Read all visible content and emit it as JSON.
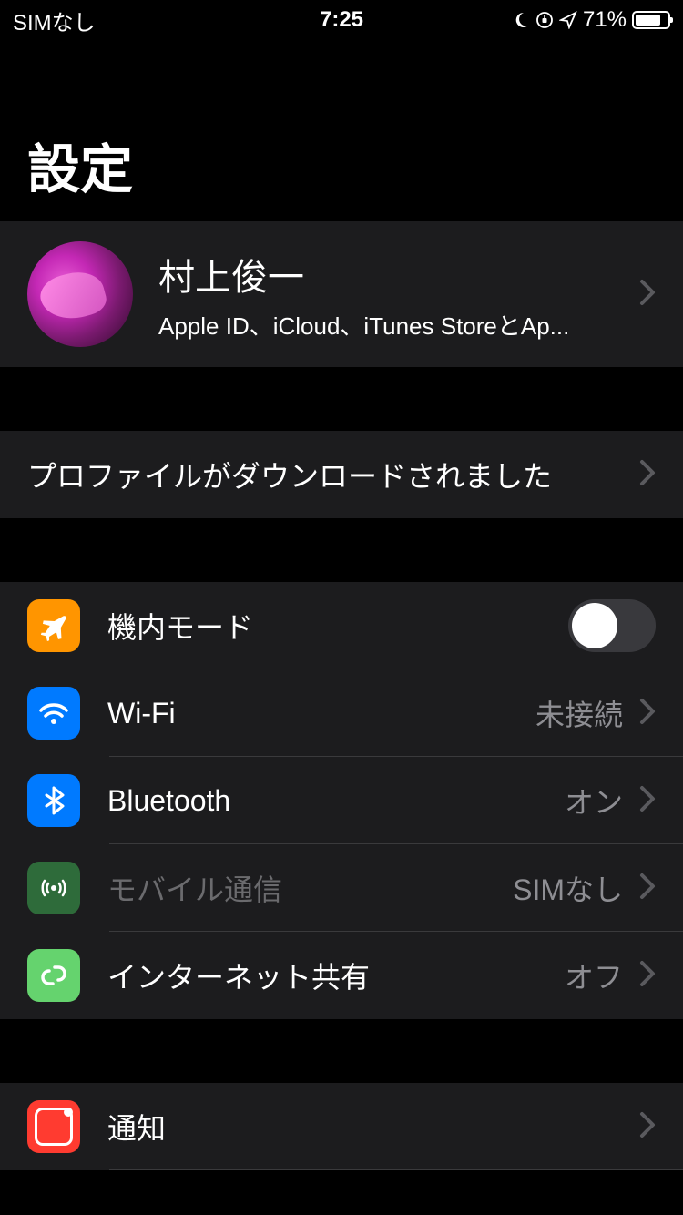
{
  "status_bar": {
    "carrier": "SIMなし",
    "time": "7:25",
    "battery_percent": "71%"
  },
  "page_title": "設定",
  "profile": {
    "name": "村上俊一",
    "subtitle": "Apple ID、iCloud、iTunes StoreとAp..."
  },
  "profile_download": {
    "label": "プロファイルがダウンロードされました"
  },
  "connectivity": {
    "airplane": {
      "label": "機内モード",
      "on": false
    },
    "wifi": {
      "label": "Wi-Fi",
      "value": "未接続"
    },
    "bluetooth": {
      "label": "Bluetooth",
      "value": "オン"
    },
    "cellular": {
      "label": "モバイル通信",
      "value": "SIMなし",
      "disabled": true
    },
    "hotspot": {
      "label": "インターネット共有",
      "value": "オフ"
    }
  },
  "notifications": {
    "label": "通知"
  }
}
